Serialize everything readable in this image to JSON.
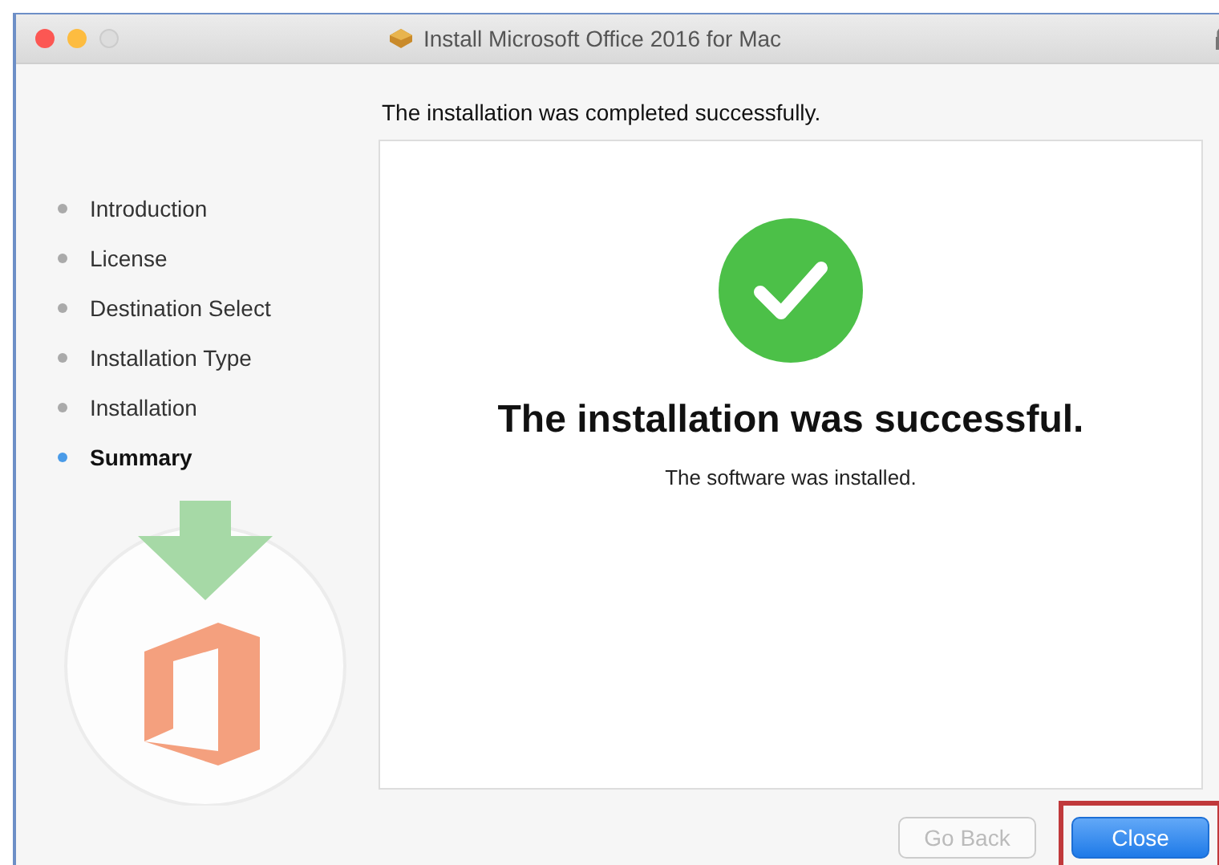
{
  "window": {
    "title": "Install Microsoft Office 2016 for Mac"
  },
  "header": "The installation was completed successfully.",
  "steps": [
    {
      "label": "Introduction",
      "selected": false
    },
    {
      "label": "License",
      "selected": false
    },
    {
      "label": "Destination Select",
      "selected": false
    },
    {
      "label": "Installation Type",
      "selected": false
    },
    {
      "label": "Installation",
      "selected": false
    },
    {
      "label": "Summary",
      "selected": true
    }
  ],
  "result": {
    "heading": "The installation was successful.",
    "message": "The software was installed."
  },
  "buttons": [
    {
      "label": "Go Back",
      "disabled": true,
      "highlighted": false
    },
    {
      "label": "Close",
      "disabled": false,
      "highlighted": true
    }
  ]
}
